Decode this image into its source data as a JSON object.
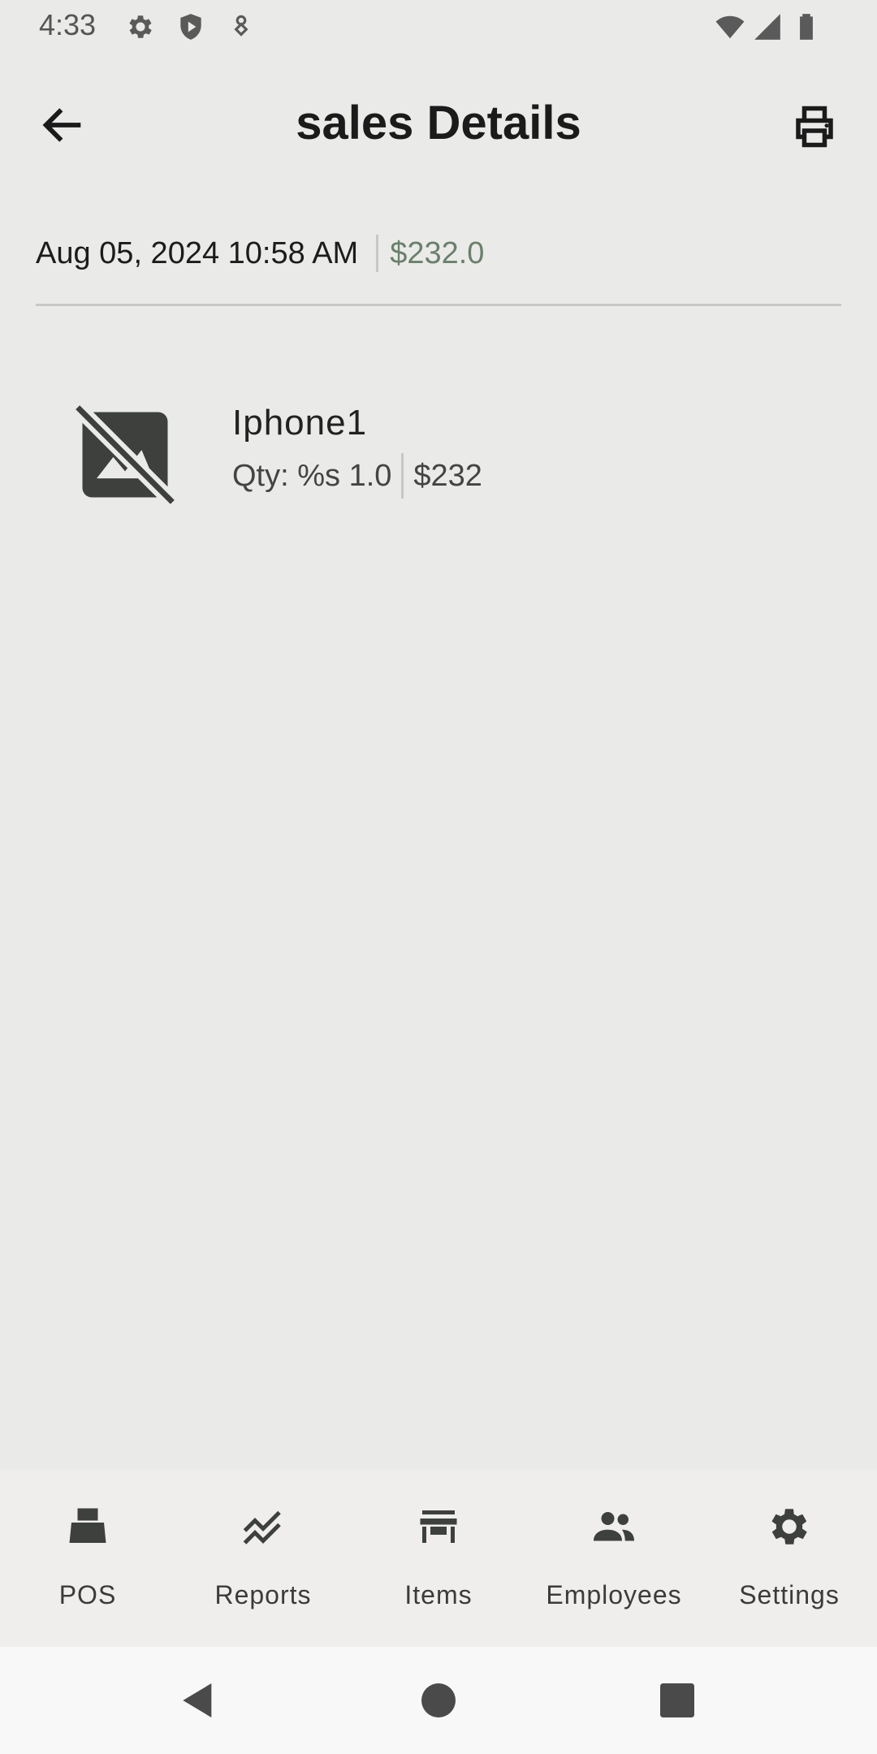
{
  "status_bar": {
    "time": "4:33",
    "icons": [
      "gear-icon",
      "shield-icon",
      "location-pin-icon",
      "wifi-icon",
      "cell-signal-icon",
      "battery-icon"
    ]
  },
  "app_bar": {
    "title": "sales Details",
    "back_icon": "arrow-left-icon",
    "print_icon": "printer-icon"
  },
  "summary": {
    "datetime": "Aug 05, 2024 10:58 AM",
    "total": "$232.0",
    "total_color": "#6b7f6c"
  },
  "items": [
    {
      "name": "Iphone1",
      "qty": "Qty: %s 1.0",
      "price": "$232",
      "image_icon": "image-not-supported-icon"
    }
  ],
  "bottom_nav": {
    "items": [
      {
        "label": "POS",
        "icon": "cash-register-icon"
      },
      {
        "label": "Reports",
        "icon": "trend-chart-icon"
      },
      {
        "label": "Items",
        "icon": "store-icon"
      },
      {
        "label": "Employees",
        "icon": "people-icon"
      },
      {
        "label": "Settings",
        "icon": "gear-icon"
      }
    ]
  },
  "system_nav": {
    "icons": [
      "back-triangle-icon",
      "home-circle-icon",
      "recents-square-icon"
    ]
  }
}
